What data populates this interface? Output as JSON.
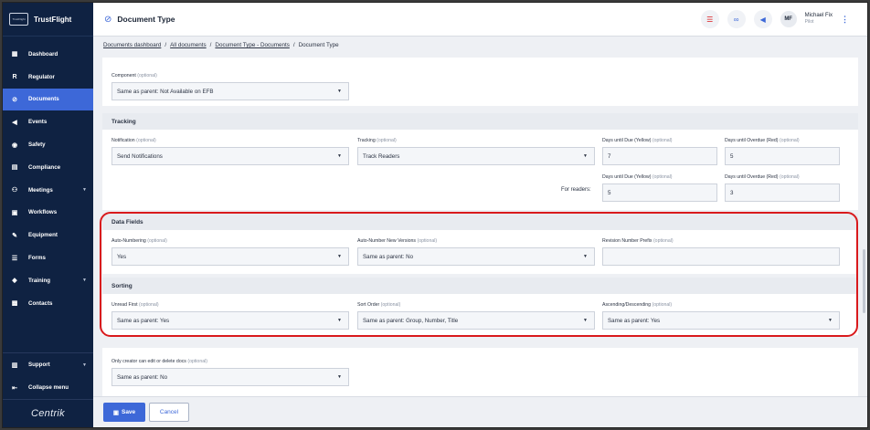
{
  "app": {
    "brand": "TrustFlight",
    "logo_text": "TrustFlight",
    "footer_brand": "Centrik"
  },
  "sidebar": {
    "items": [
      {
        "label": "Dashboard",
        "icon": "dashboard-icon"
      },
      {
        "label": "Regulator",
        "icon": "regulator-icon"
      },
      {
        "label": "Documents",
        "icon": "documents-icon"
      },
      {
        "label": "Events",
        "icon": "events-icon"
      },
      {
        "label": "Safety",
        "icon": "safety-icon"
      },
      {
        "label": "Compliance",
        "icon": "compliance-icon"
      },
      {
        "label": "Meetings",
        "icon": "meetings-icon"
      },
      {
        "label": "Workflows",
        "icon": "workflows-icon"
      },
      {
        "label": "Equipment",
        "icon": "equipment-icon"
      },
      {
        "label": "Forms",
        "icon": "forms-icon"
      },
      {
        "label": "Training",
        "icon": "training-icon"
      },
      {
        "label": "Contacts",
        "icon": "contacts-icon"
      }
    ],
    "support": "Support",
    "collapse": "Collapse menu",
    "active": "Documents"
  },
  "header": {
    "title": "Document Type",
    "user_initials": "MF",
    "user_name": "Michael Fix",
    "user_role": "Pilot"
  },
  "breadcrumb": {
    "items": [
      "Documents dashboard",
      "All documents",
      "Document Type - Documents",
      "Document Type"
    ]
  },
  "component": {
    "label": "Component",
    "optional": "(optional)",
    "value": "Same as parent: Not Available on EFB"
  },
  "tracking": {
    "title": "Tracking",
    "notification": {
      "label": "Notification",
      "optional": "(optional)",
      "value": "Send Notifications"
    },
    "tracking": {
      "label": "Tracking",
      "optional": "(optional)",
      "value": "Track Readers"
    },
    "due_yellow": {
      "label": "Days until Due (Yellow)",
      "optional": "(optional)",
      "value": "7"
    },
    "overdue_red": {
      "label": "Days until Overdue (Red)",
      "optional": "(optional)",
      "value": "5"
    },
    "for_readers": "For readers:",
    "readers_due_yellow": {
      "label": "Days until Due (Yellow)",
      "optional": "(optional)",
      "value": "5"
    },
    "readers_overdue_red": {
      "label": "Days until Overdue (Red)",
      "optional": "(optional)",
      "value": "3"
    }
  },
  "data_fields": {
    "title": "Data Fields",
    "auto_numbering": {
      "label": "Auto-Numbering",
      "optional": "(optional)",
      "value": "Yes"
    },
    "auto_number_versions": {
      "label": "Auto-Number New Versions",
      "optional": "(optional)",
      "value": "Same as parent: No"
    },
    "revision_prefix": {
      "label": "Revision Number Prefix",
      "optional": "(optional)",
      "value": ""
    }
  },
  "sorting": {
    "title": "Sorting",
    "unread_first": {
      "label": "Unread First",
      "optional": "(optional)",
      "value": "Same as parent: Yes"
    },
    "sort_order": {
      "label": "Sort Order",
      "optional": "(optional)",
      "value": "Same as parent: Group, Number, Title"
    },
    "asc_desc": {
      "label": "Ascending/Descending",
      "optional": "(optional)",
      "value": "Same as parent: Yes"
    }
  },
  "creator_edit": {
    "label": "Only creator can edit or delete docs",
    "optional": "(optional)",
    "value": "Same as parent: No"
  },
  "footer": {
    "save": "Save",
    "cancel": "Cancel"
  },
  "colors": {
    "sidebar": "#0f2242",
    "accent": "#3d68d8",
    "highlight": "#d9191c"
  }
}
